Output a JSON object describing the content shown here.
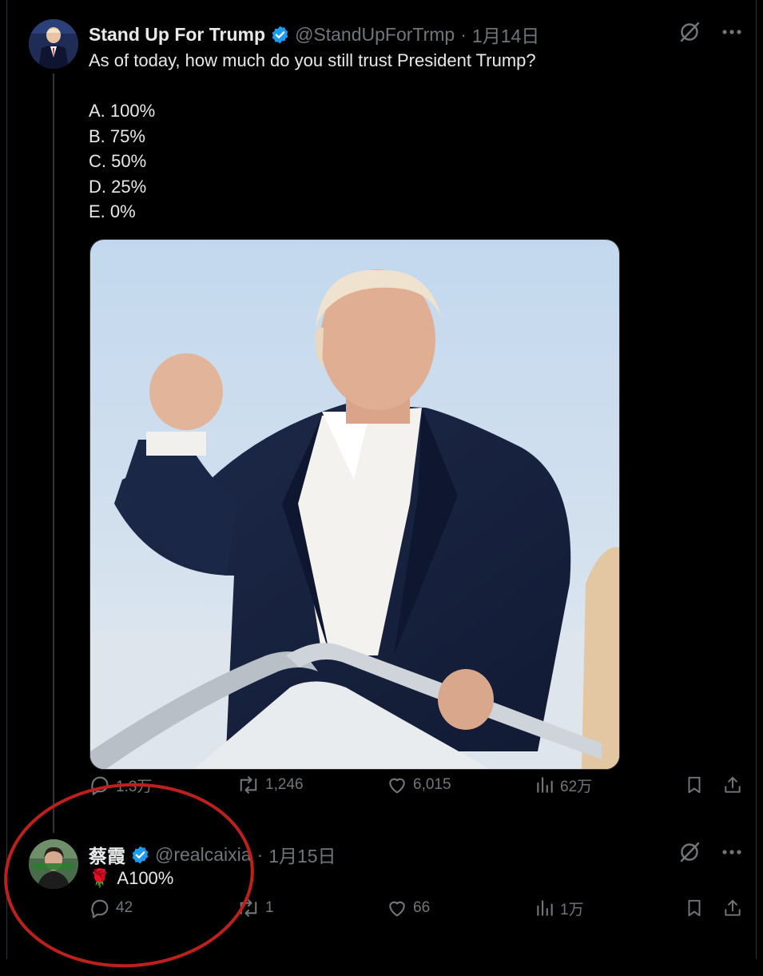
{
  "post": {
    "display_name": "Stand Up For Trump",
    "handle": "@StandUpForTrmp",
    "separator": "·",
    "date": "1月14日",
    "text_lines": [
      "As of today, how much do you still trust President Trump?",
      "",
      "A. 100%",
      "B. 75%",
      "C. 50%",
      "D. 25%",
      "E. 0%"
    ],
    "stats": {
      "replies": "1.3万",
      "reposts": "1,246",
      "likes": "6,015",
      "views": "62万"
    }
  },
  "reply": {
    "display_name": "蔡霞",
    "handle": "@realcaixia",
    "separator": "·",
    "date": "1月15日",
    "emoji": "🌹",
    "text": "A100%",
    "stats": {
      "replies": "42",
      "reposts": "1",
      "likes": "66",
      "views": "1万"
    }
  },
  "icons": {
    "verified": "verified-badge-icon",
    "grok": "grok-icon",
    "more": "more-icon",
    "reply": "reply-icon",
    "repost": "repost-icon",
    "like": "like-icon",
    "views": "views-icon",
    "bookmark": "bookmark-icon",
    "share": "share-icon"
  },
  "colors": {
    "background": "#000000",
    "text": "#e7e9ea",
    "muted": "#71767b",
    "verified": "#1d9bf0",
    "annotation_circle": "#c0201b"
  }
}
